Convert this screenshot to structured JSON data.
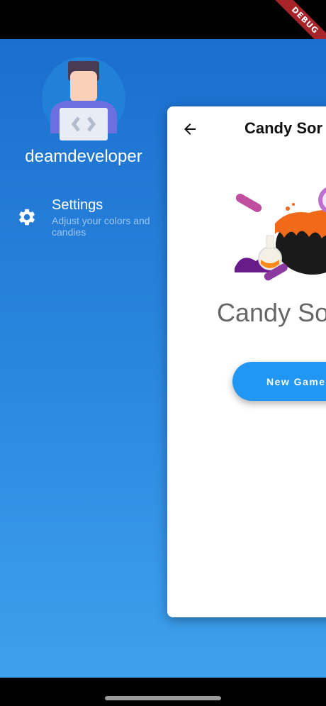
{
  "drawer": {
    "username": "deamdeveloper",
    "settings": {
      "title": "Settings",
      "subtitle": "Adjust your colors and candies"
    }
  },
  "card": {
    "header_title": "Candy Sor",
    "big_title": "Candy So",
    "new_game_label": "New Game"
  },
  "debug_banner": "DEBUG",
  "colors": {
    "accent": "#2196f3",
    "drawer_top": "#1b6fcf",
    "drawer_bottom": "#3ea0ee"
  }
}
